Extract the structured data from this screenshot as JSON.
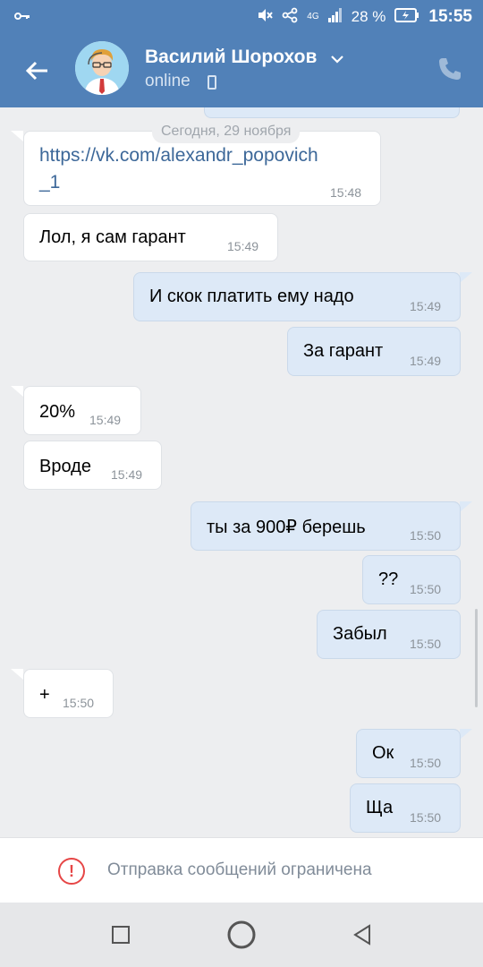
{
  "status_bar": {
    "network": "4G",
    "battery": "28 %",
    "time": "15:55"
  },
  "header": {
    "contact_name": "Василий Шорохов",
    "status": "online",
    "icons": {
      "back": "arrow-left-icon",
      "menu": "chevron-down-icon",
      "device": "phone-device-icon",
      "call": "phone-call-icon"
    }
  },
  "chat": {
    "date_separator": "Сегодня, 29 ноября",
    "messages": [
      {
        "direction": "in",
        "text_line1": "https://vk.com/alexandr_popovich",
        "text_line2": "_1",
        "time": "15:48",
        "is_link": true
      },
      {
        "direction": "in",
        "text": "Лол, я сам гарант",
        "time": "15:49"
      },
      {
        "direction": "out",
        "text": "И скок платить ему надо",
        "time": "15:49"
      },
      {
        "direction": "out",
        "text": "За гарант",
        "time": "15:49"
      },
      {
        "direction": "in",
        "text": "20%",
        "time": "15:49"
      },
      {
        "direction": "in",
        "text": "Вроде",
        "time": "15:49"
      },
      {
        "direction": "out",
        "text": "ты за 900₽ берешь",
        "time": "15:50"
      },
      {
        "direction": "out",
        "text": "??",
        "time": "15:50"
      },
      {
        "direction": "out",
        "text": "Забыл",
        "time": "15:50"
      },
      {
        "direction": "in",
        "text": "+",
        "time": "15:50"
      },
      {
        "direction": "out",
        "text": "Ок",
        "time": "15:50"
      },
      {
        "direction": "out",
        "text": "Ща",
        "time": "15:50"
      }
    ]
  },
  "footer": {
    "restriction_text": "Отправка сообщений ограничена",
    "icon": "warning-circle-icon"
  },
  "nav": {
    "buttons": [
      "recent-apps-icon",
      "home-icon",
      "back-triangle-icon"
    ]
  },
  "colors": {
    "header_bg": "#5181b8",
    "outgoing_bubble": "#dde9f7",
    "incoming_bubble": "#ffffff",
    "link": "#3d6899",
    "warning": "#e64646"
  }
}
